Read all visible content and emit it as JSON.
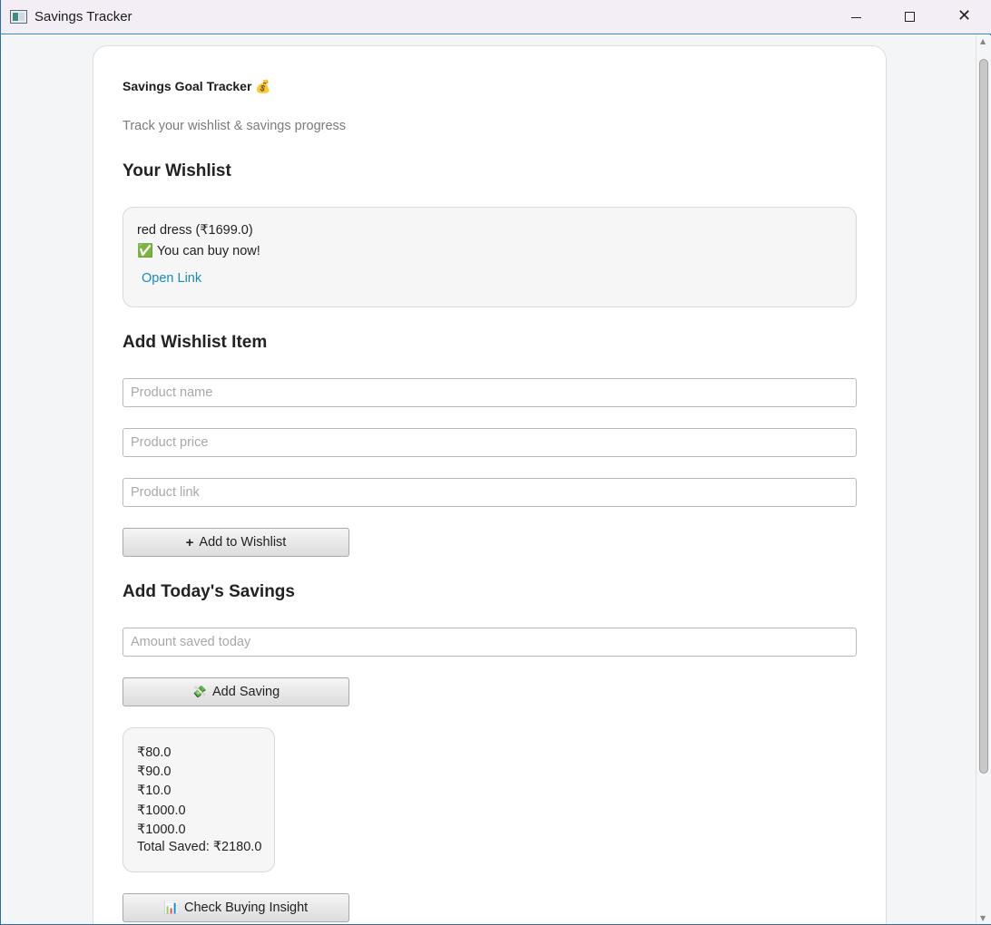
{
  "window": {
    "title": "Savings Tracker",
    "minimize_icon": "minimize-icon",
    "maximize_icon": "maximize-icon",
    "close_icon": "close-icon"
  },
  "header": {
    "title": "Savings Goal Tracker 💰",
    "subtitle": "Track your wishlist & savings progress"
  },
  "wishlist": {
    "title": "Your Wishlist",
    "items": [
      {
        "label": "red dress (₹1699.0)",
        "status": "✅ You can buy now!",
        "link_label": "Open Link"
      }
    ]
  },
  "add_item": {
    "title": "Add Wishlist Item",
    "name_placeholder": "Product name",
    "price_placeholder": "Product price",
    "link_placeholder": "Product link",
    "button_icon": "+",
    "button_label": "Add to Wishlist"
  },
  "add_savings": {
    "title": "Add Today's Savings",
    "amount_placeholder": "Amount saved today",
    "button_icon": "💸",
    "button_label": "Add Saving"
  },
  "savings": {
    "entries": [
      "₹80.0",
      "₹90.0",
      "₹10.0",
      "₹1000.0",
      "₹1000.0"
    ],
    "total": "Total Saved: ₹2180.0"
  },
  "insight": {
    "button_icon": "📊",
    "button_label": "Check Buying Insight"
  },
  "colors": {
    "link": "#1a8bb8",
    "title_bar": "#f3eef5",
    "background": "#f4f5f7"
  }
}
